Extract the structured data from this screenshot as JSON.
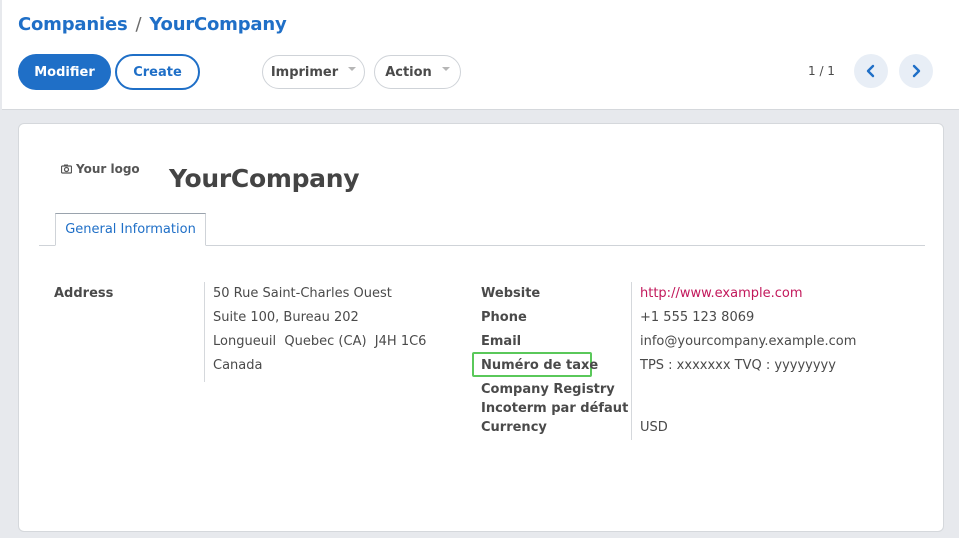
{
  "breadcrumb": {
    "parent": "Companies",
    "separator": "/",
    "current": "YourCompany"
  },
  "toolbar": {
    "edit_label": "Modifier",
    "create_label": "Create",
    "print_label": "Imprimer",
    "action_label": "Action"
  },
  "pager": {
    "value": "1 / 1"
  },
  "icons": {
    "prev": "chevron-left-icon",
    "next": "chevron-right-icon",
    "logo": "camera-icon"
  },
  "colors": {
    "accent": "#1f6fc7",
    "link": "#c2185b",
    "highlight": "#5ac85a"
  },
  "form": {
    "logo_label": "Your logo",
    "company_name": "YourCompany",
    "tab_label": "General Information",
    "address": {
      "label": "Address",
      "lines": [
        "50 Rue Saint-Charles Ouest",
        "Suite 100, Bureau 202",
        "Longueuil  Quebec (CA)  J4H 1C6",
        "Canada"
      ]
    },
    "fields": [
      {
        "label": "Website",
        "value": "http://www.example.com"
      },
      {
        "label": "Phone",
        "value": "+1 555 123 8069"
      },
      {
        "label": "Email",
        "value": "info@yourcompany.example.com"
      },
      {
        "label": "Numéro de taxe",
        "value": "TPS : xxxxxxx TVQ : yyyyyyyy"
      },
      {
        "label": "Company Registry",
        "value": ""
      },
      {
        "label": "Incoterm par défaut",
        "value": ""
      },
      {
        "label": "Currency",
        "value": "USD"
      }
    ]
  }
}
